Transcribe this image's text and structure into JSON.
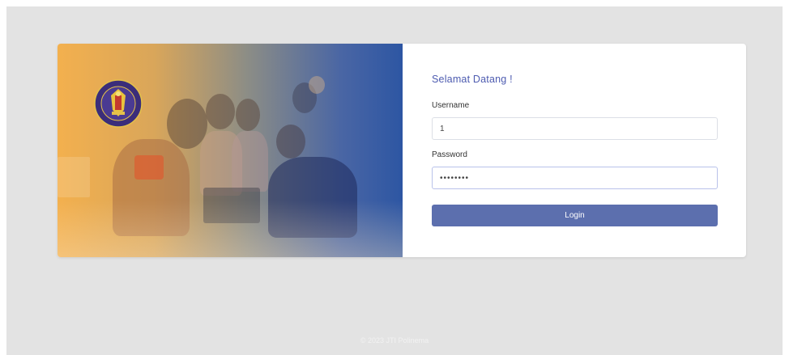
{
  "login": {
    "title": "Selamat Datang !",
    "username_label": "Username",
    "username_value": "1",
    "password_label": "Password",
    "password_value": "12345678",
    "login_button": "Login"
  },
  "footer": {
    "text": "© 2023 JTI Polinema"
  },
  "colors": {
    "accent": "#5c6fae",
    "title": "#4d5bb0",
    "hero_left": "#f3b04e",
    "hero_right": "#2d56a3"
  },
  "icons": {
    "logo": "polinema-logo"
  }
}
